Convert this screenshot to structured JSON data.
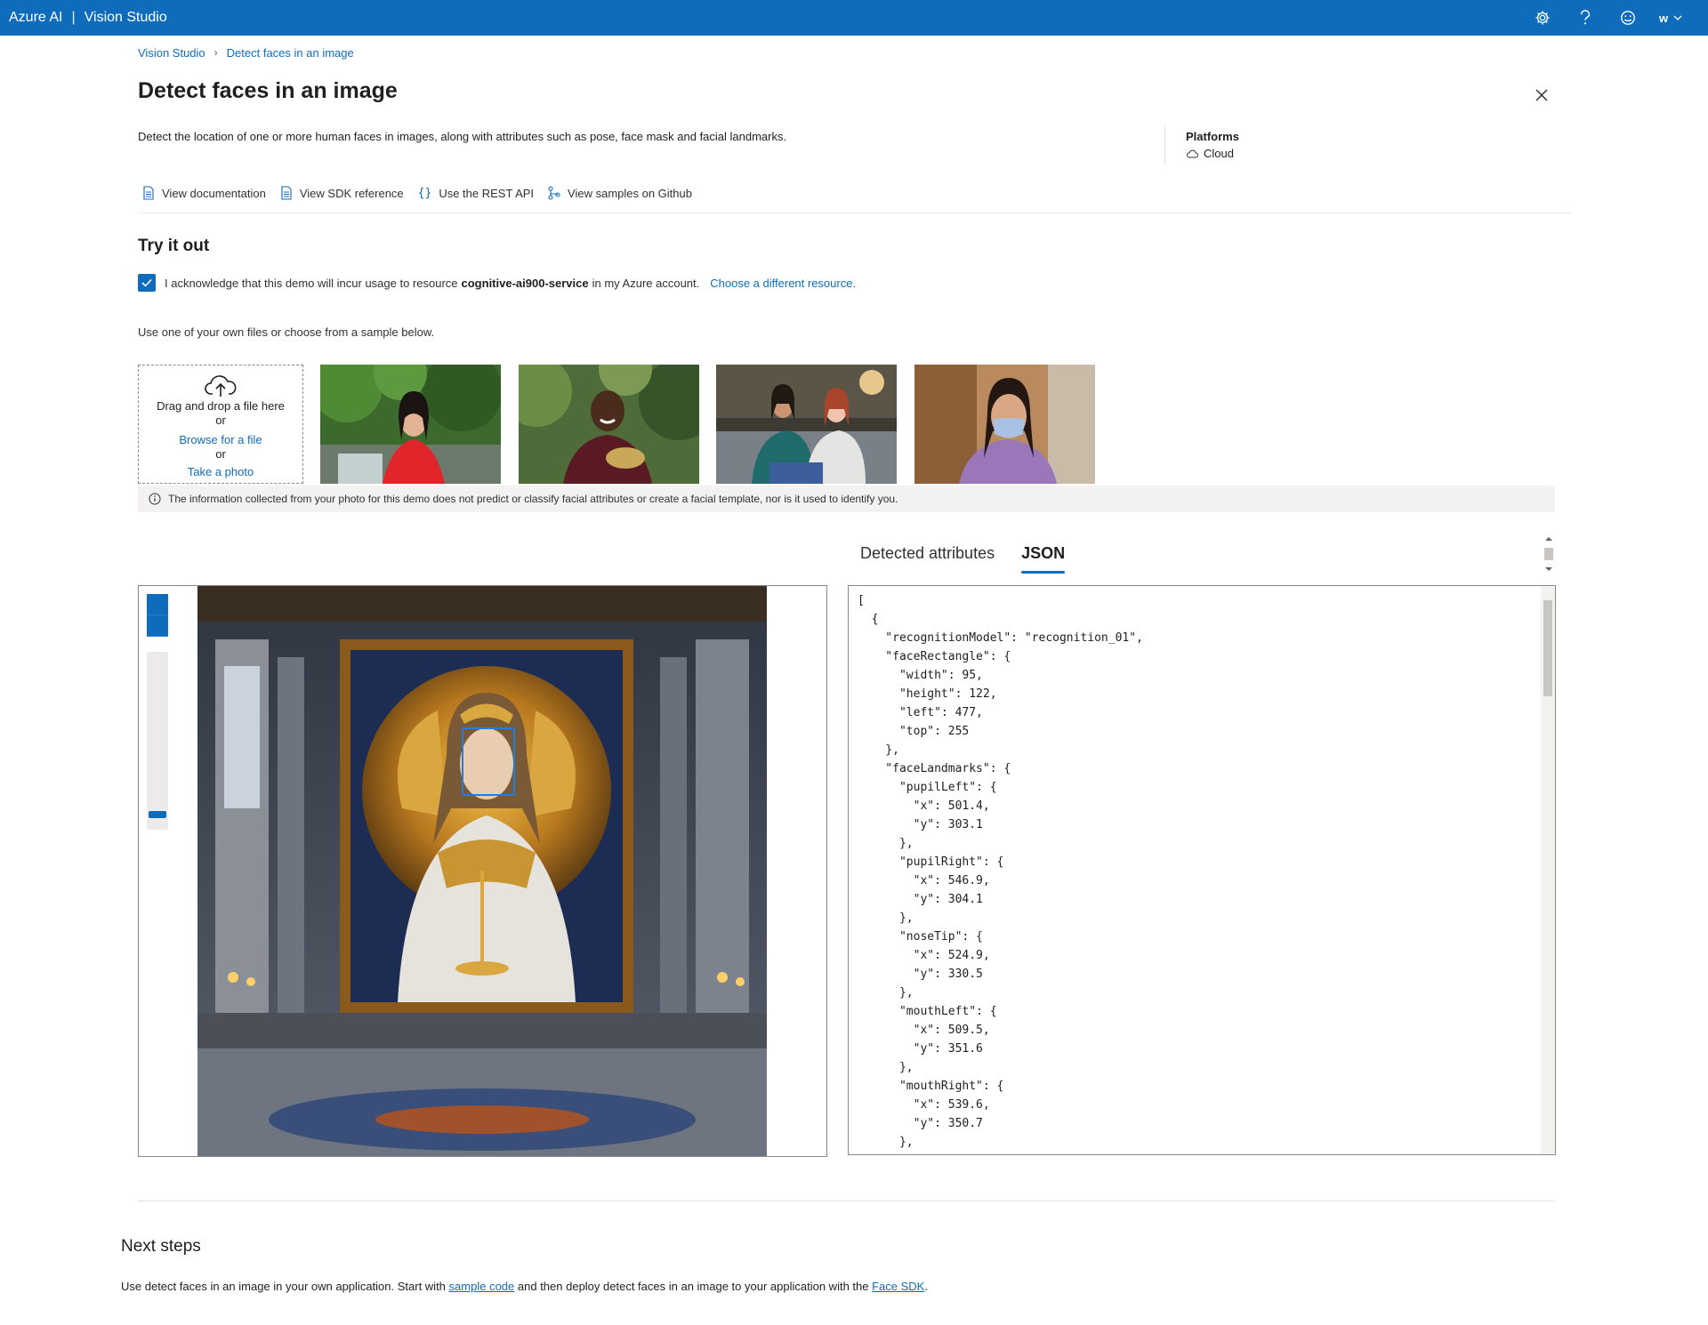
{
  "topbar": {
    "brand_azure": "Azure AI",
    "brand_sep": "|",
    "brand_app": "Vision Studio",
    "user_initial": "w"
  },
  "breadcrumb": {
    "root": "Vision Studio",
    "current": "Detect faces in an image"
  },
  "page": {
    "title": "Detect faces in an image",
    "description": "Detect the location of one or more human faces in images, along with attributes such as pose, face mask and facial landmarks."
  },
  "platforms": {
    "heading": "Platforms",
    "value": "Cloud"
  },
  "resource_links": [
    {
      "label": "View documentation",
      "icon": "document-icon"
    },
    {
      "label": "View SDK reference",
      "icon": "document-icon"
    },
    {
      "label": "Use the REST API",
      "icon": "braces-icon"
    },
    {
      "label": "View samples on Github",
      "icon": "branch-icon"
    }
  ],
  "try_it": {
    "title": "Try it out",
    "ack_before": "I acknowledge that this demo will incur usage to resource",
    "resource_name": "cognitive-ai900-service",
    "ack_after": "in my Azure account.",
    "choose_link": "Choose a different resource.",
    "ack_checked": true,
    "use_own": "Use one of your own files or choose from a sample below."
  },
  "dropzone": {
    "drag_text": "Drag and drop a file here",
    "or1": "or",
    "browse": "Browse for a file",
    "or2": "or",
    "take_photo": "Take a photo"
  },
  "info_notice": "The information collected from your photo for this demo does not predict or classify facial attributes or create a facial template, nor is it used to identify you.",
  "tabs": [
    {
      "label": "Detected attributes",
      "active": false
    },
    {
      "label": "JSON",
      "active": true
    }
  ],
  "json_lines": [
    "[",
    "  {",
    "    \"recognitionModel\": \"recognition_01\",",
    "    \"faceRectangle\": {",
    "      \"width\": 95,",
    "      \"height\": 122,",
    "      \"left\": 477,",
    "      \"top\": 255",
    "    },",
    "    \"faceLandmarks\": {",
    "      \"pupilLeft\": {",
    "        \"x\": 501.4,",
    "        \"y\": 303.1",
    "      },",
    "      \"pupilRight\": {",
    "        \"x\": 546.9,",
    "        \"y\": 304.1",
    "      },",
    "      \"noseTip\": {",
    "        \"x\": 524.9,",
    "        \"y\": 330.5",
    "      },",
    "      \"mouthLeft\": {",
    "        \"x\": 509.5,",
    "        \"y\": 351.6",
    "      },",
    "      \"mouthRight\": {",
    "        \"x\": 539.6,",
    "        \"y\": 350.7",
    "      },"
  ],
  "next_steps": {
    "title": "Next steps",
    "text_1": "Use detect faces in an image in your own application. Start with",
    "link_1": "sample code",
    "text_2": "and then deploy detect faces in an image to your application with the",
    "link_2": "Face SDK",
    "text_3": "."
  },
  "colors": {
    "accent": "#0f6cbd",
    "face_box": "#1e7fe0"
  }
}
